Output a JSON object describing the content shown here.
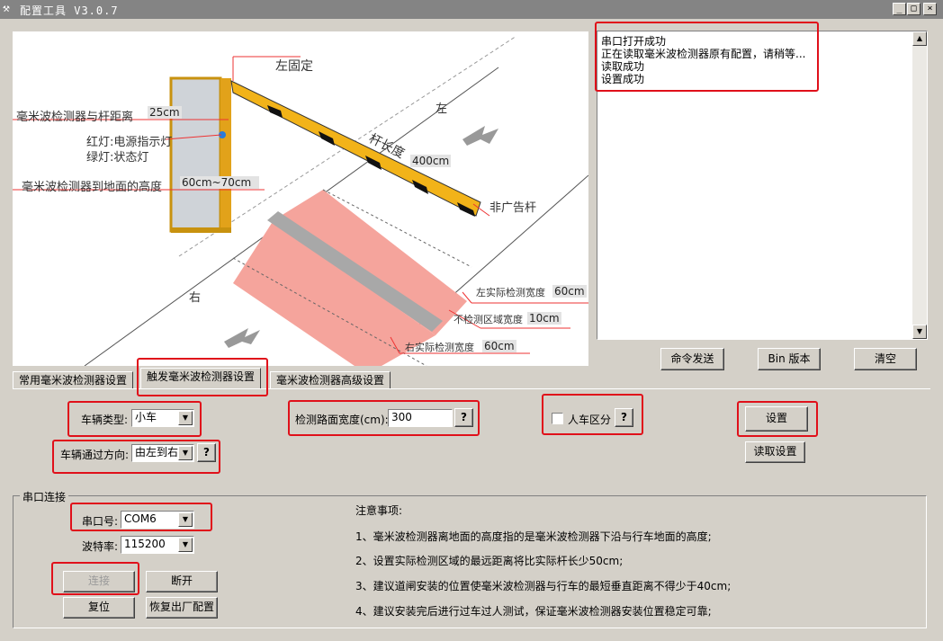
{
  "window": {
    "title": "配置工具 V3.0.7",
    "app_icon": "tools-icon",
    "controls": [
      "_",
      "□",
      "×"
    ]
  },
  "diagram": {
    "left_fixed": "左固定",
    "distance_label": "毫米波检测器与杆距离",
    "distance_value": "25cm",
    "red_light": "红灯:电源指示灯",
    "green_light": "绿灯:状态灯",
    "height_label": "毫米波检测器到地面的高度",
    "height_value": "60cm~70cm",
    "pole_length_label": "杆长度",
    "pole_length_value": "400cm",
    "non_ad_pole": "非广告杆",
    "left_side": "左",
    "right_side": "右",
    "left_width_label": "左实际检测宽度",
    "left_width_value": "60cm",
    "no_detect_label": "不检测区域宽度",
    "no_detect_value": "10cm",
    "right_width_label": "右实际检测宽度",
    "right_width_value": "60cm"
  },
  "log": {
    "lines": [
      "串口打开成功",
      "正在读取毫米波检测器原有配置，请稍等...",
      "读取成功",
      "设置成功"
    ]
  },
  "log_buttons": {
    "send": "命令发送",
    "bin": "Bin 版本",
    "clear": "清空"
  },
  "tabs": [
    "常用毫米波检测器设置",
    "触发毫米波检测器设置",
    "毫米波检测器高级设置"
  ],
  "settings": {
    "vehicle_type_label": "车辆类型:",
    "vehicle_type_value": "小车",
    "direction_label": "车辆通过方向:",
    "direction_value": "由左到右",
    "road_width_label": "检测路面宽度(cm):",
    "road_width_value": "300",
    "person_vehicle_label": "人车区分",
    "help": "?",
    "set_button": "设置",
    "read_button": "读取设置"
  },
  "serial": {
    "group_title": "串口连接",
    "port_label": "串口号:",
    "port_value": "COM6",
    "baud_label": "波特率:",
    "baud_value": "115200",
    "connect": "连接",
    "disconnect": "断开",
    "reset": "复位",
    "factory": "恢复出厂配置"
  },
  "notes": {
    "title": "注意事项:",
    "items": [
      "1、毫米波检测器离地面的高度指的是毫米波检测器下沿与行车地面的高度;",
      "2、设置实际检测区域的最远距离将比实际杆长少50cm;",
      "3、建议道闸安装的位置使毫米波检测器与行车的最短垂直距离不得少于40cm;",
      "4、建议安装完后进行过车过人测试，保证毫米波检测器安装位置稳定可靠;"
    ]
  },
  "colors": {
    "highlight_box": "#e0101a",
    "detect_zone": "#f5a49c",
    "barrier_yellow": "#f2b319"
  }
}
